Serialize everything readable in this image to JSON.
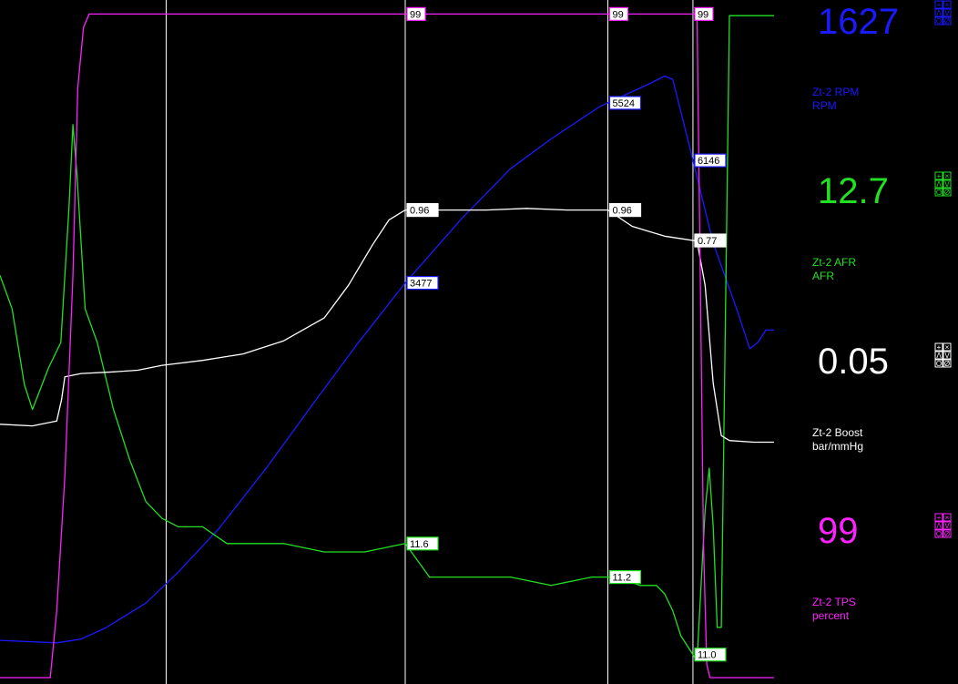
{
  "chart_data": {
    "type": "line",
    "title": "",
    "x_unit": "",
    "x_range": [
      0,
      100
    ],
    "series": [
      {
        "name": "Zt-2 RPM",
        "unit": "RPM",
        "color": "#1a1aff",
        "current_value": "1627",
        "y_range": [
          1300,
          6700
        ],
        "points": [
          [
            0,
            1600
          ],
          [
            7,
            1580
          ],
          [
            10,
            1610
          ],
          [
            13,
            1700
          ],
          [
            18,
            1900
          ],
          [
            22,
            2150
          ],
          [
            27,
            2500
          ],
          [
            33,
            3000
          ],
          [
            38,
            3450
          ],
          [
            44,
            3980
          ],
          [
            50,
            4480
          ],
          [
            57,
            5000
          ],
          [
            63,
            5400
          ],
          [
            68,
            5640
          ],
          [
            74,
            5900
          ],
          [
            80,
            6080
          ],
          [
            82,
            6146
          ],
          [
            83,
            6120
          ],
          [
            85,
            5600
          ],
          [
            88,
            4800
          ],
          [
            91,
            4250
          ],
          [
            92.5,
            3950
          ],
          [
            93.5,
            4000
          ],
          [
            94.5,
            4100
          ],
          [
            95.5,
            4100
          ]
        ]
      },
      {
        "name": "Zt-2 AFR",
        "unit": "AFR",
        "color": "#22e022",
        "current_value": "12.7",
        "y_range": [
          10.0,
          18.0
        ],
        "points": [
          [
            0,
            14.8
          ],
          [
            1.5,
            14.4
          ],
          [
            3,
            13.5
          ],
          [
            4,
            13.2
          ],
          [
            6,
            13.7
          ],
          [
            7.5,
            14.0
          ],
          [
            8.5,
            15.6
          ],
          [
            9,
            16.6
          ],
          [
            9.5,
            16.0
          ],
          [
            10.5,
            14.4
          ],
          [
            12,
            14.0
          ],
          [
            14,
            13.2
          ],
          [
            16,
            12.6
          ],
          [
            18,
            12.1
          ],
          [
            20,
            11.9
          ],
          [
            22,
            11.8
          ],
          [
            25,
            11.8
          ],
          [
            28,
            11.6
          ],
          [
            31,
            11.6
          ],
          [
            35,
            11.6
          ],
          [
            40,
            11.5
          ],
          [
            45,
            11.5
          ],
          [
            50,
            11.6
          ],
          [
            53,
            11.2
          ],
          [
            58,
            11.2
          ],
          [
            63,
            11.2
          ],
          [
            68,
            11.1
          ],
          [
            73,
            11.2
          ],
          [
            76,
            11.2
          ],
          [
            79,
            11.1
          ],
          [
            81,
            11.1
          ],
          [
            82,
            11.0
          ],
          [
            83,
            10.8
          ],
          [
            84,
            10.5
          ],
          [
            86,
            10.2
          ],
          [
            87,
            12.0
          ],
          [
            87.5,
            12.5
          ],
          [
            88,
            11.8
          ],
          [
            88.5,
            10.6
          ],
          [
            89,
            10.6
          ],
          [
            90,
            17.9
          ],
          [
            92,
            17.9
          ],
          [
            95.5,
            17.9
          ]
        ]
      },
      {
        "name": "Zt-2 Boost",
        "unit": "bar/mmHg",
        "color": "#ffffff",
        "current_value": "0.05",
        "y_range": [
          -1.9,
          2.2
        ],
        "points": [
          [
            0,
            -0.35
          ],
          [
            4,
            -0.36
          ],
          [
            7,
            -0.33
          ],
          [
            7.6,
            -0.2
          ],
          [
            8,
            -0.06
          ],
          [
            10,
            -0.04
          ],
          [
            14,
            -0.03
          ],
          [
            17,
            -0.02
          ],
          [
            20,
            0.01
          ],
          [
            25,
            0.04
          ],
          [
            30,
            0.08
          ],
          [
            35,
            0.16
          ],
          [
            40,
            0.3
          ],
          [
            43,
            0.5
          ],
          [
            46,
            0.75
          ],
          [
            48,
            0.9
          ],
          [
            50,
            0.96
          ],
          [
            55,
            0.96
          ],
          [
            60,
            0.96
          ],
          [
            65,
            0.97
          ],
          [
            70,
            0.96
          ],
          [
            75,
            0.96
          ],
          [
            78,
            0.86
          ],
          [
            82,
            0.8
          ],
          [
            86,
            0.77
          ],
          [
            87,
            0.5
          ],
          [
            88,
            -0.1
          ],
          [
            89,
            -0.42
          ],
          [
            90,
            -0.45
          ],
          [
            93,
            -0.46
          ],
          [
            95.5,
            -0.46
          ]
        ]
      },
      {
        "name": "Zt-2 TPS",
        "unit": "percent",
        "color": "#ff22ff",
        "current_value": "99",
        "y_range": [
          0,
          100
        ],
        "points": [
          [
            0,
            0
          ],
          [
            6.2,
            0
          ],
          [
            7,
            10
          ],
          [
            8,
            30
          ],
          [
            9,
            60
          ],
          [
            9.6,
            88
          ],
          [
            10.3,
            97
          ],
          [
            11,
            99
          ],
          [
            20,
            99
          ],
          [
            40,
            99
          ],
          [
            60,
            99
          ],
          [
            80,
            99
          ],
          [
            86,
            99
          ],
          [
            86.4,
            60
          ],
          [
            86.8,
            20
          ],
          [
            87.2,
            2
          ],
          [
            87.6,
            0
          ],
          [
            95.5,
            0
          ]
        ]
      }
    ],
    "cursors": [
      {
        "x": 20.5
      },
      {
        "x": 50,
        "values": {
          "rpm": "3477",
          "afr": "11.6",
          "boost": "0.96",
          "tps": "99"
        }
      },
      {
        "x": 75,
        "values": {
          "rpm": "5524",
          "afr": "11.2",
          "boost": "0.96",
          "tps": "99"
        }
      },
      {
        "x": 85.5,
        "values": {
          "rpm": "6146",
          "afr": "11.0",
          "boost": "0.77",
          "tps": "99"
        }
      }
    ]
  },
  "channels": [
    {
      "key": "rpm",
      "value": "1627",
      "name": "Zt-2 RPM",
      "unit": "RPM",
      "color": "#1a1aff"
    },
    {
      "key": "afr",
      "value": "12.7",
      "name": "Zt-2 AFR",
      "unit": "AFR",
      "color": "#22e022"
    },
    {
      "key": "boost",
      "value": "0.05",
      "name": "Zt-2 Boost",
      "unit": "bar/mmHg",
      "color": "#ffffff"
    },
    {
      "key": "tps",
      "value": "99",
      "name": "Zt-2 TPS",
      "unit": "percent",
      "color": "#ff22ff"
    }
  ],
  "icons": {
    "channel_controls": "zoom-controls-icon"
  }
}
